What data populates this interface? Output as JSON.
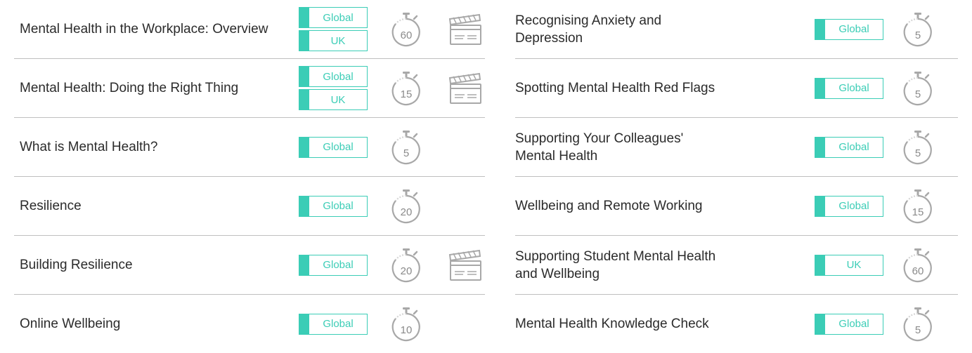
{
  "courses_left": [
    {
      "title": "Mental Health in the Workplace: Overview",
      "tags": [
        "Global",
        "UK"
      ],
      "minutes": "60",
      "has_video": true
    },
    {
      "title": "Mental Health: Doing the Right Thing",
      "tags": [
        "Global",
        "UK"
      ],
      "minutes": "15",
      "has_video": true
    },
    {
      "title": "What is Mental Health?",
      "tags": [
        "Global"
      ],
      "minutes": "5",
      "has_video": false
    },
    {
      "title": "Resilience",
      "tags": [
        "Global"
      ],
      "minutes": "20",
      "has_video": false
    },
    {
      "title": "Building Resilience",
      "tags": [
        "Global"
      ],
      "minutes": "20",
      "has_video": true
    },
    {
      "title": "Online Wellbeing",
      "tags": [
        "Global"
      ],
      "minutes": "10",
      "has_video": false
    }
  ],
  "courses_right": [
    {
      "title": "Recognising Anxiety and Depression",
      "tags": [
        "Global"
      ],
      "minutes": "5",
      "has_video": false
    },
    {
      "title": "Spotting Mental Health Red Flags",
      "tags": [
        "Global"
      ],
      "minutes": "5",
      "has_video": false
    },
    {
      "title": "Supporting Your Colleagues' Mental Health",
      "tags": [
        "Global"
      ],
      "minutes": "5",
      "has_video": false
    },
    {
      "title": "Wellbeing and Remote Working",
      "tags": [
        "Global"
      ],
      "minutes": "15",
      "has_video": false
    },
    {
      "title": "Supporting Student Mental Health and Wellbeing",
      "tags": [
        "UK"
      ],
      "minutes": "60",
      "has_video": false
    },
    {
      "title": "Mental Health Knowledge Check",
      "tags": [
        "Global"
      ],
      "minutes": "5",
      "has_video": false
    }
  ],
  "colors": {
    "accent": "#3bcdb6",
    "icon": "#a8a8a8",
    "divider": "#bfbfbf"
  },
  "icons": {
    "timer": "stopwatch-icon",
    "video": "clapperboard-icon"
  }
}
